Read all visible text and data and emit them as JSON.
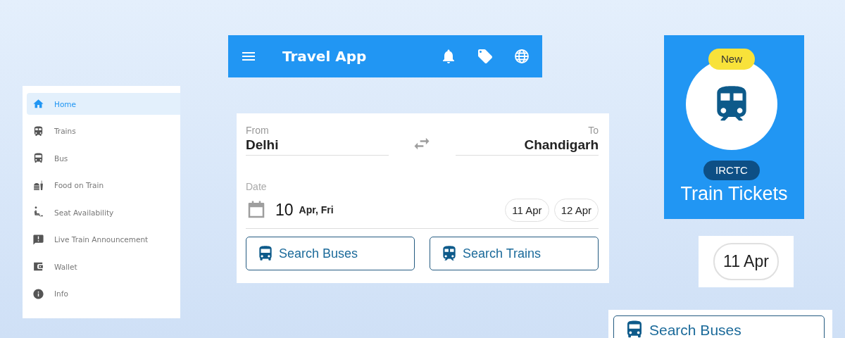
{
  "app_bar": {
    "title": "Travel App"
  },
  "sidebar": {
    "items": [
      {
        "label": "Home",
        "selected": true
      },
      {
        "label": "Trains",
        "selected": false
      },
      {
        "label": "Bus",
        "selected": false
      },
      {
        "label": "Food on Train",
        "selected": false
      },
      {
        "label": "Seat Availability",
        "selected": false
      },
      {
        "label": "Live Train Announcement",
        "selected": false
      },
      {
        "label": "Wallet",
        "selected": false
      },
      {
        "label": "Info",
        "selected": false
      }
    ]
  },
  "search_form": {
    "from": {
      "label": "From",
      "value": "Delhi"
    },
    "to": {
      "label": "To",
      "value": "Chandigarh"
    },
    "date": {
      "label": "Date",
      "day": "10",
      "rest": "Apr, Fri"
    },
    "quick_dates": [
      "11 Apr",
      "12 Apr"
    ],
    "buttons": [
      {
        "kind": "bus",
        "label": "Search Buses"
      },
      {
        "kind": "train",
        "label": "Search Trains"
      }
    ]
  },
  "tile": {
    "badge": "New",
    "tag": "IRCTC",
    "title": "Train Tickets"
  },
  "chip_preview": {
    "label": "11 Apr"
  },
  "button_preview": {
    "kind": "bus",
    "label": "Search Buses"
  }
}
